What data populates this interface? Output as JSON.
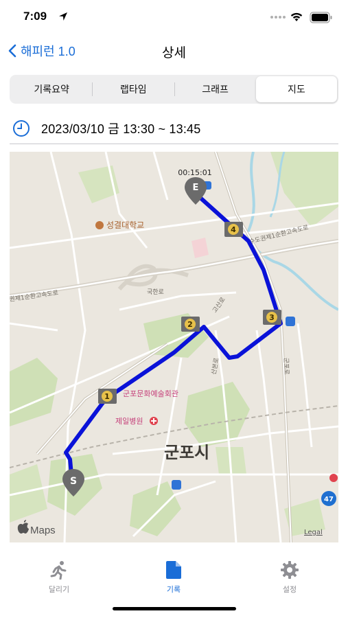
{
  "status": {
    "time": "7:09"
  },
  "nav": {
    "back_label": "해피런 1.0",
    "title": "상세"
  },
  "tabs": [
    {
      "label": "기록요약",
      "selected": false
    },
    {
      "label": "랩타임",
      "selected": false
    },
    {
      "label": "그래프",
      "selected": false
    },
    {
      "label": "지도",
      "selected": true
    }
  ],
  "record": {
    "datetime": "2023/03/10 금 13:30 ~ 13:45"
  },
  "map": {
    "end_time": "00:15:01",
    "start_marker": "S",
    "end_marker": "E",
    "laps": [
      "1",
      "2",
      "3",
      "4"
    ],
    "labels": {
      "university": "성결대학교",
      "arts_center": "군포문화예술회관",
      "hospital": "제일병원",
      "city": "군포시",
      "highway": "수도권제1순환고속도로",
      "highway_short": "권제1순환고속도로",
      "road_gunpo": "군포로",
      "road_sanbon": "산본로",
      "road_goan": "고산로",
      "road_gukil": "국한로",
      "route_number": "47",
      "attribution": "Maps",
      "legal": "Legal"
    },
    "route_color": "#0a12d8"
  },
  "tabbar": {
    "items": [
      {
        "label": "달리기",
        "icon": "running-icon",
        "active": false
      },
      {
        "label": "기록",
        "icon": "document-icon",
        "active": true
      },
      {
        "label": "설정",
        "icon": "gear-icon",
        "active": false
      }
    ]
  }
}
